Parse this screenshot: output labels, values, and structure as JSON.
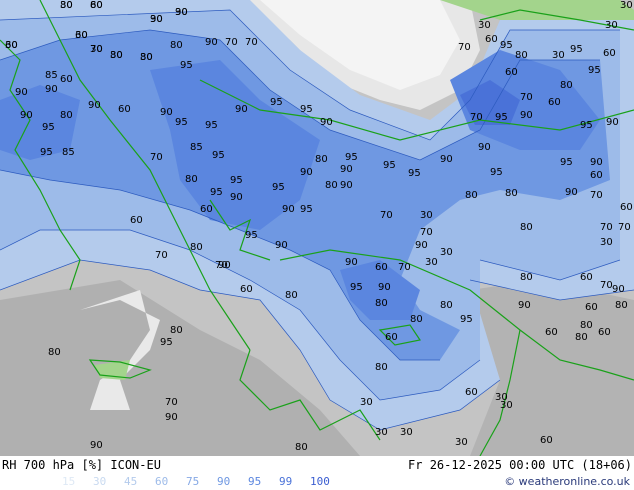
{
  "header": {
    "product": "RH 700 hPa [%] ICON-EU",
    "valid": "Fr 26-12-2025 00:00 UTC (18+06)"
  },
  "legend": {
    "levels": [
      "15",
      "30",
      "45",
      "60",
      "75",
      "90",
      "95",
      "99",
      "100"
    ],
    "colors": [
      "#dfe9f5",
      "#c9daf0",
      "#b4cbec",
      "#9dbbe9",
      "#86a9e5",
      "#6f98e2",
      "#5b86df",
      "#4a72d8",
      "#3b5ed1"
    ]
  },
  "credit": "© weatheronline.co.uk",
  "map_colors": {
    "land_grey": "#b8b8b8",
    "light_grey": "#d6d6d6",
    "coast": "#1aa11a",
    "contour": "#2d5bbf",
    "green_patch": "#a3d48c"
  },
  "contour_labels": [
    "80",
    "80",
    "90",
    "90",
    "60",
    "60",
    "70",
    "80",
    "80",
    "80",
    "90",
    "95",
    "70",
    "70",
    "90",
    "85",
    "90",
    "60",
    "90",
    "95",
    "80",
    "90",
    "60",
    "90",
    "95",
    "95",
    "90",
    "95",
    "95",
    "90",
    "95",
    "85",
    "85",
    "95",
    "90",
    "95",
    "95",
    "95",
    "90",
    "95",
    "80",
    "70",
    "90",
    "70",
    "95",
    "60",
    "60",
    "90",
    "95",
    "80",
    "90",
    "80",
    "80",
    "80",
    "95",
    "95",
    "90",
    "95",
    "95",
    "90",
    "95",
    "95",
    "90",
    "90",
    "60",
    "70",
    "80",
    "80",
    "30",
    "70",
    "70",
    "90",
    "80",
    "90",
    "80",
    "60",
    "70",
    "90",
    "80",
    "70",
    "30",
    "80",
    "60",
    "70",
    "60",
    "70",
    "30",
    "90",
    "80",
    "60",
    "80",
    "60",
    "80",
    "60",
    "90",
    "95",
    "60",
    "95",
    "30",
    "30",
    "95",
    "80",
    "60",
    "60",
    "70",
    "70",
    "95",
    "90",
    "60",
    "95",
    "90",
    "80",
    "30",
    "30",
    "70",
    "90",
    "30",
    "60",
    "80",
    "60",
    "30",
    "30",
    "30",
    "30",
    "30",
    "30",
    "60",
    "60",
    "70",
    "80",
    "90",
    "90",
    "90",
    "70",
    "80",
    "95",
    "80",
    "80",
    "30",
    "60",
    "30",
    "30",
    "30",
    "30",
    "30",
    "30",
    "30"
  ]
}
